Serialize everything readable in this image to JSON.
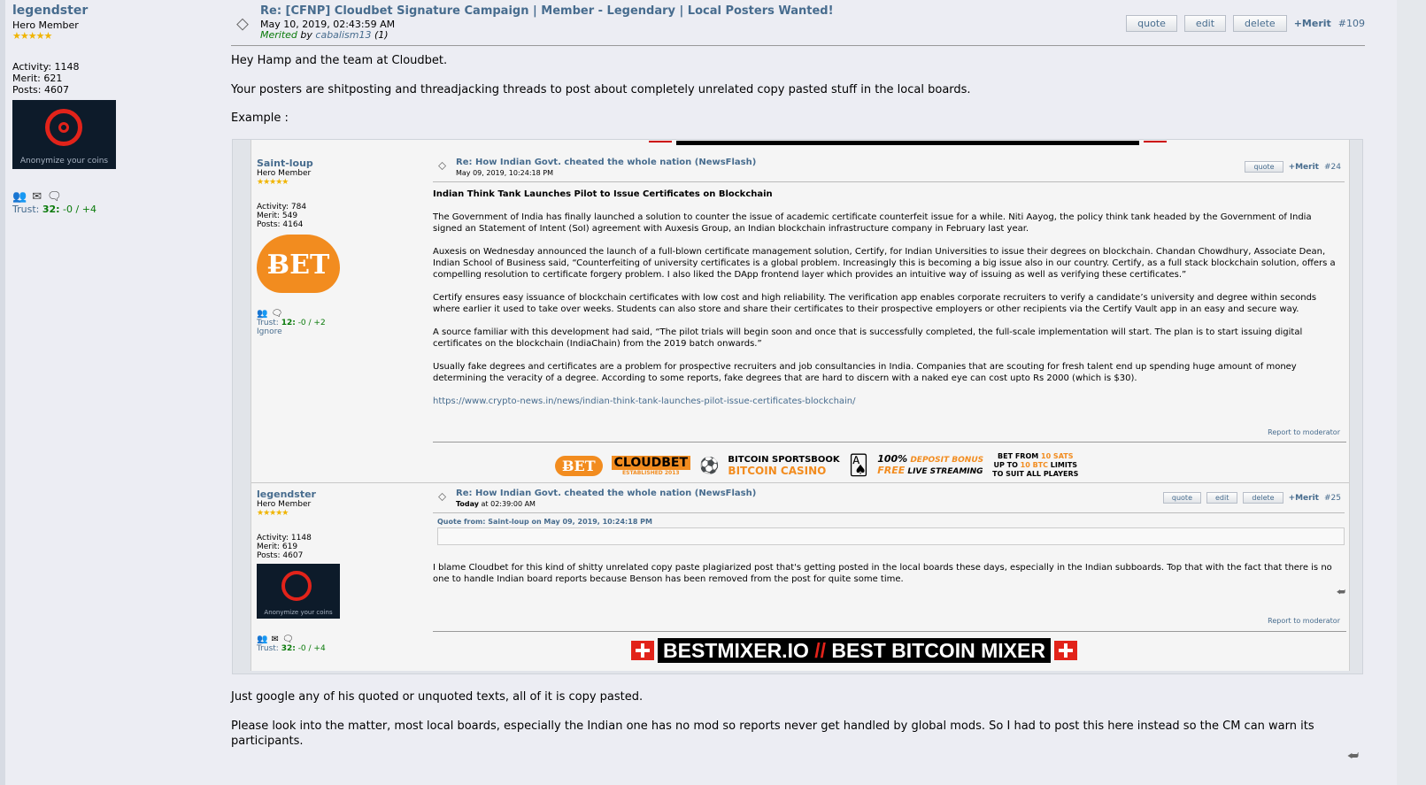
{
  "outer_poster": {
    "name": "legendster",
    "rank": "Hero Member",
    "stars": "★★★★★",
    "activity": "Activity: 1148",
    "merit": "Merit: 621",
    "posts": "Posts: 4607",
    "avatar_caption": "Anonymize your coins",
    "trust_label": "Trust: ",
    "trust_value": "32:",
    "trust_rest": " -0 / +4"
  },
  "main_post": {
    "title": "Re: [CFNP] Cloudbet Signature Campaign | Member - Legendary | Local Posters Wanted!",
    "date": "May 10, 2019, 02:43:59 AM",
    "merited_prefix": "Merited",
    "merited_by": " by ",
    "merited_user": "cabalism13",
    "merited_count": " (1)",
    "buttons": {
      "quote": "quote",
      "edit": "edit",
      "delete": "delete"
    },
    "merit_label": "+Merit",
    "number": "#109",
    "para1": "Hey Hamp and the team at Cloudbet.",
    "para2": "Your posters are shitposting and threadjacking threads to post about completely unrelated copy pasted stuff in the local boards.",
    "para3": "Example :",
    "para4": "Just google any of his quoted or unquoted texts, all of it is copy pasted.",
    "para5": "Please look into the matter, most local boards, especially the Indian one has no mod so reports never get handled by global mods. So I had to post this here instead so the CM can warn its participants."
  },
  "embed_post1": {
    "name": "Saint-loup",
    "rank": "Hero Member",
    "stars": "★★★★★",
    "activity": "Activity: 784",
    "merit": "Merit: 549",
    "posts": "Posts: 4164",
    "avatar_text": "ɃET",
    "trust_label": "Trust: ",
    "trust_value": "12:",
    "trust_rest": " -0 / +2",
    "ignore": "Ignore",
    "title": "Re: How Indian Govt. cheated the whole nation (NewsFlash)",
    "date": "May 09, 2019, 10:24:18 PM",
    "quote": "quote",
    "merit_label": "+Merit",
    "number": "#24",
    "headline": "Indian Think Tank Launches Pilot to Issue Certificates on Blockchain",
    "p1": "The Government of India has finally launched a solution to counter the issue of academic certificate counterfeit issue for a while. Niti Aayog, the policy think tank headed by the Government of India signed an Statement of Intent (SoI) agreement with Auxesis Group, an Indian blockchain infrastructure company in February last year.",
    "p2": "Auxesis on Wednesday announced the launch of a full-blown certificate management solution, Certify, for Indian Universities to issue their degrees on blockchain. Chandan Chowdhury, Associate Dean, Indian School of Business said, “Counterfeiting of university certificates is a global problem. Increasingly this is becoming a big issue also in our country. Certify, as a full stack blockchain solution, offers a compelling resolution to certificate forgery problem. I also liked the DApp frontend layer which provides an intuitive way of issuing as well as verifying these certificates.”",
    "p3": "Certify ensures easy issuance of blockchain certificates with low cost and high reliability. The verification app enables corporate recruiters to verify a candidate’s university and degree within seconds where earlier it used to take over weeks. Students can also store and share their certificates to their prospective employers or other recipients via the Certify Vault app in an easy and secure way.",
    "p4": "A source familiar with this development had said, “The pilot trials will begin soon and once that is successfully completed, the full-scale implementation will start. The plan is to start issuing digital certificates on the blockchain (IndiaChain) from the 2019 batch onwards.”",
    "p5": "Usually fake degrees and certificates are a problem for prospective recruiters and job consultancies in India. Companies that are scouting for fresh talent end up spending huge amount of money determining the veracity of a degree. According to some reports, fake degrees that are hard to discern with a naked eye can cost upto Rs 2000 (which is $30).",
    "link": "https://www.crypto-news.in/news/indian-think-tank-launches-pilot-issue-certificates-blockchain/",
    "report": "Report to moderator"
  },
  "sig_banner1": {
    "bet": "ɃET",
    "cloudbet": "CLOUDBET",
    "established": "ESTABLISHED 2013",
    "sportsbook": "BITCOIN SPORTSBOOK",
    "casino": "BITCOIN CASINO",
    "deposit_pct": "100%",
    "deposit_bonus": " DEPOSIT BONUS",
    "free": "FREE",
    "live": " LIVE STREAMING",
    "bet_from": "BET FROM ",
    "sats": "10 SATS",
    "up_to": "UP TO ",
    "btc": "10 BTC",
    "limits": " LIMITS",
    "suit": "TO SUIT ALL PLAYERS"
  },
  "embed_post2": {
    "name": "legendster",
    "rank": "Hero Member",
    "stars": "★★★★★",
    "activity": "Activity: 1148",
    "merit": "Merit: 619",
    "posts": "Posts: 4607",
    "avatar_caption": "Anonymize your coins",
    "trust_label": "Trust: ",
    "trust_value": "32:",
    "trust_rest": " -0 / +4",
    "title": "Re: How Indian Govt. cheated the whole nation (NewsFlash)",
    "date_bold": "Today",
    "date_rest": " at 02:39:00 AM",
    "quote": "quote",
    "edit": "edit",
    "delete": "delete",
    "merit_label": "+Merit",
    "number": "#25",
    "quote_from": "Quote from: Saint-loup on May 09, 2019, 10:24:18 PM",
    "body": "I blame Cloudbet for this kind of shitty unrelated copy paste plagiarized post that's getting posted in the local boards these days, especially in the Indian subboards. Top that with the fact that there is no one to handle Indian board reports because Benson has been removed from the post for quite some time.",
    "report": "Report to moderator"
  },
  "sig_banner2": {
    "text_a": "BESTMIXER.IO ",
    "text_sep": "//",
    "text_b": " BEST BITCOIN MIXER"
  }
}
